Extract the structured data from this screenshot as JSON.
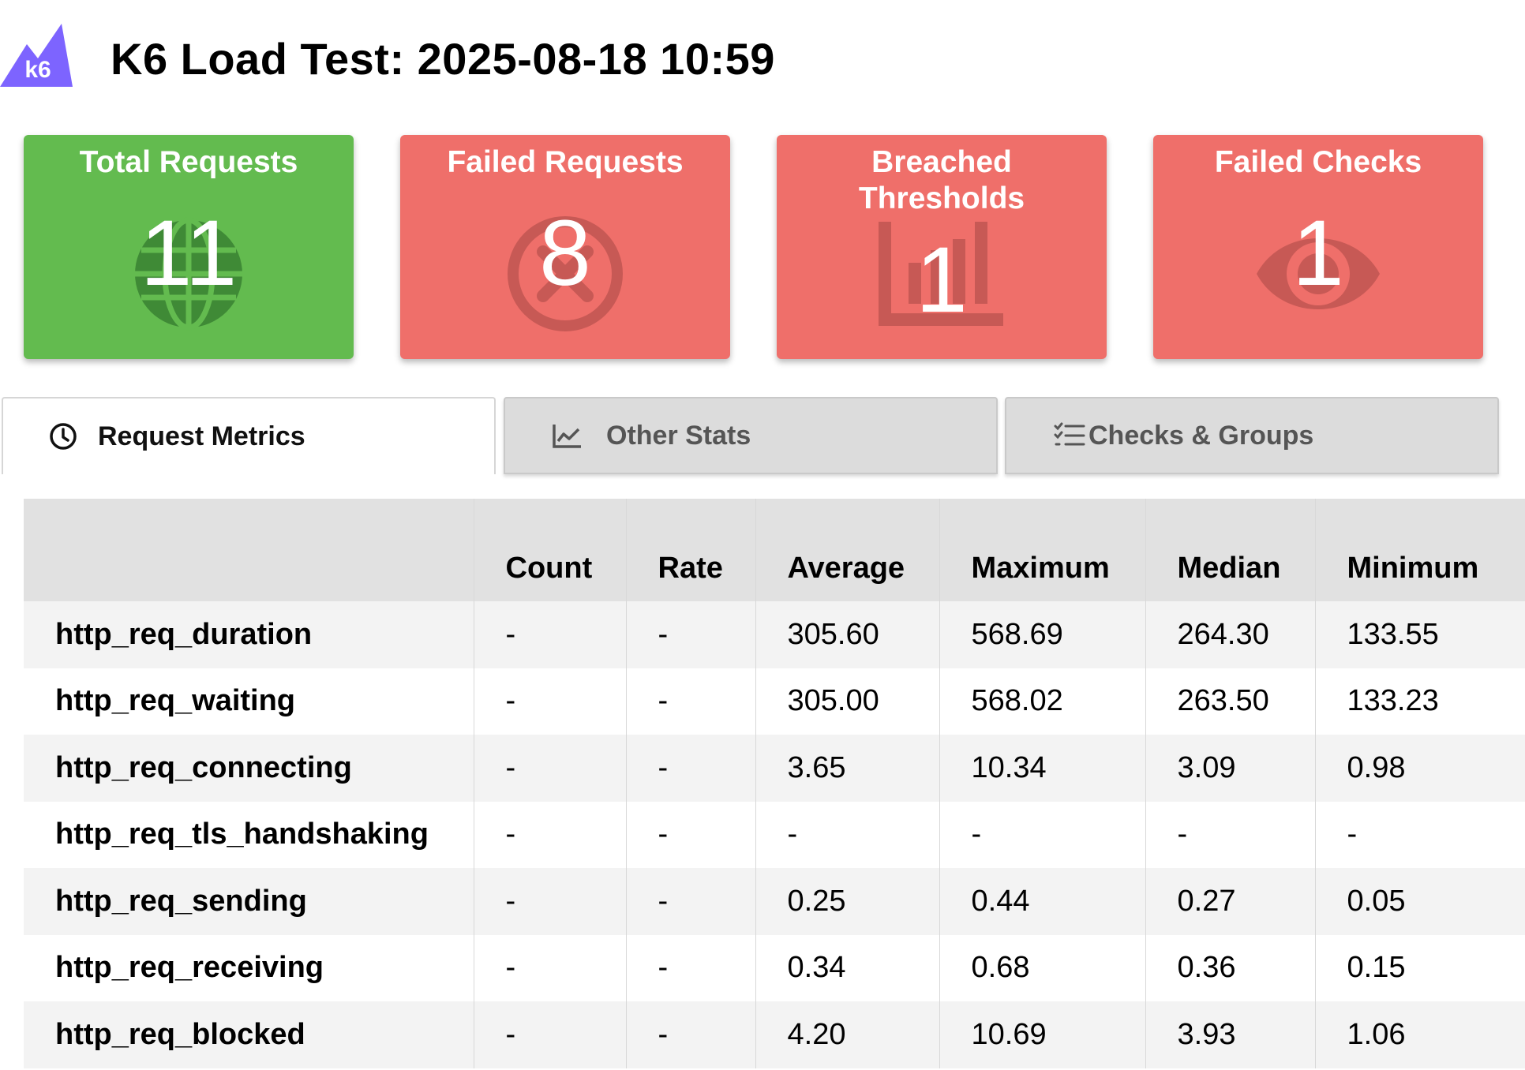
{
  "header": {
    "logo_text": "k6",
    "title": "K6 Load Test: 2025-08-18 10:59"
  },
  "colors": {
    "brand_purple": "#7d64ff",
    "success_green": "#63bb4f",
    "failure_red": "#ef6f6a",
    "icon_green": "#3f8a36",
    "icon_red": "#c75955"
  },
  "cards": [
    {
      "title": "Total Requests",
      "value": "11",
      "icon": "globe-icon",
      "status": "success"
    },
    {
      "title": "Failed Requests",
      "value": "8",
      "icon": "circle-x-icon",
      "status": "failure"
    },
    {
      "title": "Breached Thresholds",
      "value": "1",
      "icon": "bar-chart-icon",
      "status": "failure"
    },
    {
      "title": "Failed Checks",
      "value": "1",
      "icon": "eye-icon",
      "status": "failure"
    }
  ],
  "tabs": [
    {
      "label": "Request Metrics",
      "icon": "clock-icon",
      "active": true
    },
    {
      "label": "Other Stats",
      "icon": "line-chart-icon",
      "active": false
    },
    {
      "label": "Checks & Groups",
      "icon": "list-check-icon",
      "active": false
    }
  ],
  "table": {
    "columns": [
      "",
      "Count",
      "Rate",
      "Average",
      "Maximum",
      "Median",
      "Minimum"
    ],
    "rows": [
      [
        "http_req_duration",
        "-",
        "-",
        "305.60",
        "568.69",
        "264.30",
        "133.55"
      ],
      [
        "http_req_waiting",
        "-",
        "-",
        "305.00",
        "568.02",
        "263.50",
        "133.23"
      ],
      [
        "http_req_connecting",
        "-",
        "-",
        "3.65",
        "10.34",
        "3.09",
        "0.98"
      ],
      [
        "http_req_tls_handshaking",
        "-",
        "-",
        "-",
        "-",
        "-",
        "-"
      ],
      [
        "http_req_sending",
        "-",
        "-",
        "0.25",
        "0.44",
        "0.27",
        "0.05"
      ],
      [
        "http_req_receiving",
        "-",
        "-",
        "0.34",
        "0.68",
        "0.36",
        "0.15"
      ],
      [
        "http_req_blocked",
        "-",
        "-",
        "4.20",
        "10.69",
        "3.93",
        "1.06"
      ]
    ]
  }
}
